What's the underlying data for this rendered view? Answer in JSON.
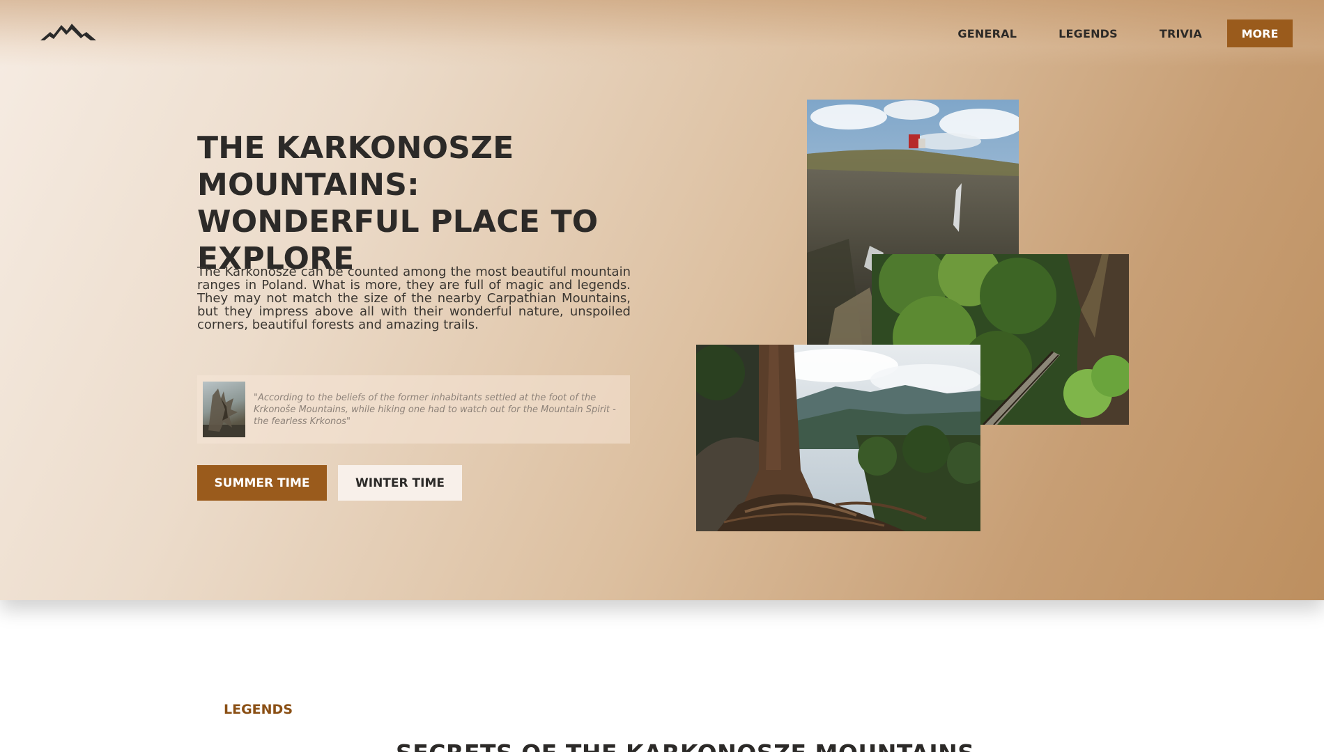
{
  "header": {
    "logo_icon": "mountain-logo-icon",
    "nav": {
      "general": "GENERAL",
      "legends": "LEGENDS",
      "trivia": "TRIVIA",
      "more": "MORE"
    }
  },
  "hero": {
    "title": "THE KARKONOSZE MOUNTAINS: WONDERFUL PLACE TO EXPLORE",
    "description": "The Karkonosze can be counted among the most beautiful mountain ranges in Poland. What is more, they are full of magic and legends. They may not match the size of the nearby Carpathian Mountains, but they impress above all with their wonderful nature, unspoiled corners, beautiful forests and amazing trails.",
    "quote": "\"According to the beliefs of the former inhabitants settled at the foot of the Krkonoše Mountains, while hiking one had to watch out for the Mountain Spirit - the fearless Krkonos\"",
    "buttons": {
      "summer": "SUMMER TIME",
      "winter": "WINTER TIME"
    },
    "images": [
      "cliff-with-mountain-hut-photo",
      "forest-walkway-photo",
      "pine-tree-roots-photo"
    ]
  },
  "legends_section": {
    "label": "LEGENDS",
    "title": "SECRETS OF THE KARKONOSZE MOUNTAINS"
  },
  "colors": {
    "accent": "#9a5b1c",
    "hero_gradient_start": "#f6ece3",
    "hero_gradient_end": "#bd8f5f",
    "text_dark": "#2c2a28"
  }
}
